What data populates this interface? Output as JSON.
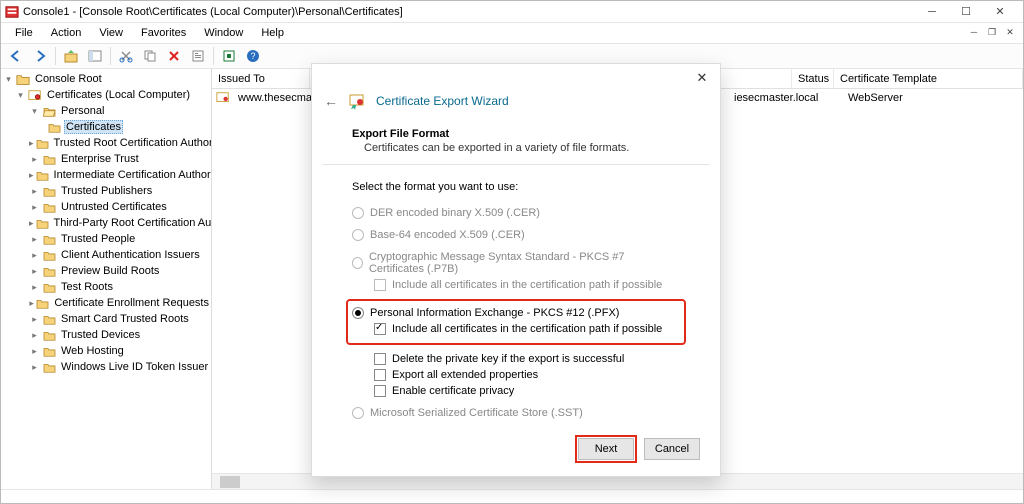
{
  "titlebar": {
    "title": "Console1 - [Console Root\\Certificates (Local Computer)\\Personal\\Certificates]"
  },
  "menubar": {
    "items": [
      "File",
      "Action",
      "View",
      "Favorites",
      "Window",
      "Help"
    ]
  },
  "tree": {
    "root": "Console Root",
    "certs_root": "Certificates (Local Computer)",
    "personal": "Personal",
    "certificates": "Certificates",
    "items": [
      "Trusted Root Certification Authorities",
      "Enterprise Trust",
      "Intermediate Certification Authorities",
      "Trusted Publishers",
      "Untrusted Certificates",
      "Third-Party Root Certification Authorities",
      "Trusted People",
      "Client Authentication Issuers",
      "Preview Build Roots",
      "Test Roots",
      "Certificate Enrollment Requests",
      "Smart Card Trusted Roots",
      "Trusted Devices",
      "Web Hosting",
      "Windows Live ID Token Issuer"
    ]
  },
  "list": {
    "columns": {
      "issued_to": "Issued To",
      "partial_col": "I",
      "status": "Status",
      "template": "Certificate Template"
    },
    "row": {
      "issued_to": "www.thesecmaster.l",
      "partial": "iesecmaster.local",
      "template": "WebServer"
    }
  },
  "wizard": {
    "title": "Certificate Export Wizard",
    "heading": "Export File Format",
    "subtitle": "Certificates can be exported in a variety of file formats.",
    "lead": "Select the format you want to use:",
    "opts": {
      "der": "DER encoded binary X.509 (.CER)",
      "b64": "Base-64 encoded X.509 (.CER)",
      "p7b": "Cryptographic Message Syntax Standard - PKCS #7 Certificates (.P7B)",
      "p7b_sub": "Include all certificates in the certification path if possible",
      "pfx": "Personal Information Exchange - PKCS #12 (.PFX)",
      "pfx_include": "Include all certificates in the certification path if possible",
      "pfx_delete": "Delete the private key if the export is successful",
      "pfx_ext": "Export all extended properties",
      "pfx_priv": "Enable certificate privacy",
      "sst": "Microsoft Serialized Certificate Store (.SST)"
    },
    "buttons": {
      "next": "Next",
      "cancel": "Cancel"
    }
  }
}
